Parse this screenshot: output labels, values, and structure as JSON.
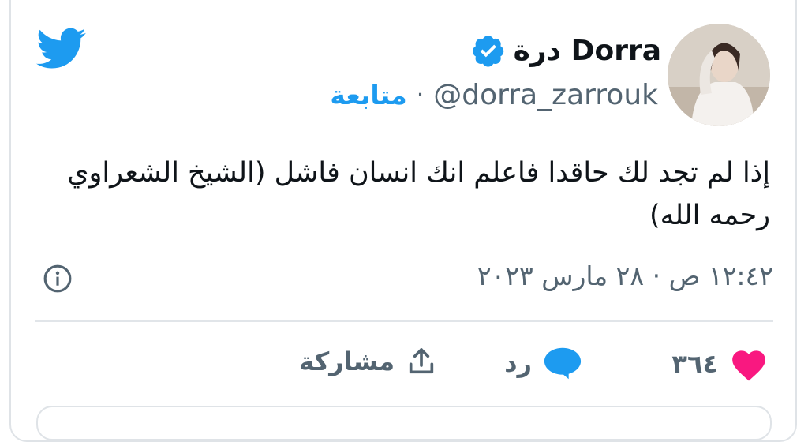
{
  "user": {
    "name": "درة Dorra",
    "handle": "@dorra_zarrouk",
    "follow_label": "متابعة",
    "separator": "·",
    "verified": true
  },
  "tweet": {
    "text": "إذا لم تجد لك حاقدا فاعلم انك انسان فاشل (الشيخ الشعراوي رحمه الله)",
    "timestamp": "١٢:٤٢ ص · ٢٨ مارس ٢٠٢٣"
  },
  "actions": {
    "like_count": "٣٦٤",
    "reply_label": "رد",
    "share_label": "مشاركة"
  },
  "colors": {
    "twitter_blue": "#1d9bf0",
    "like_pink": "#f91880",
    "secondary_text": "#536471"
  },
  "icons": [
    "twitter-logo-icon",
    "verified-badge-icon",
    "info-icon",
    "heart-icon",
    "reply-bubble-icon",
    "share-icon"
  ]
}
